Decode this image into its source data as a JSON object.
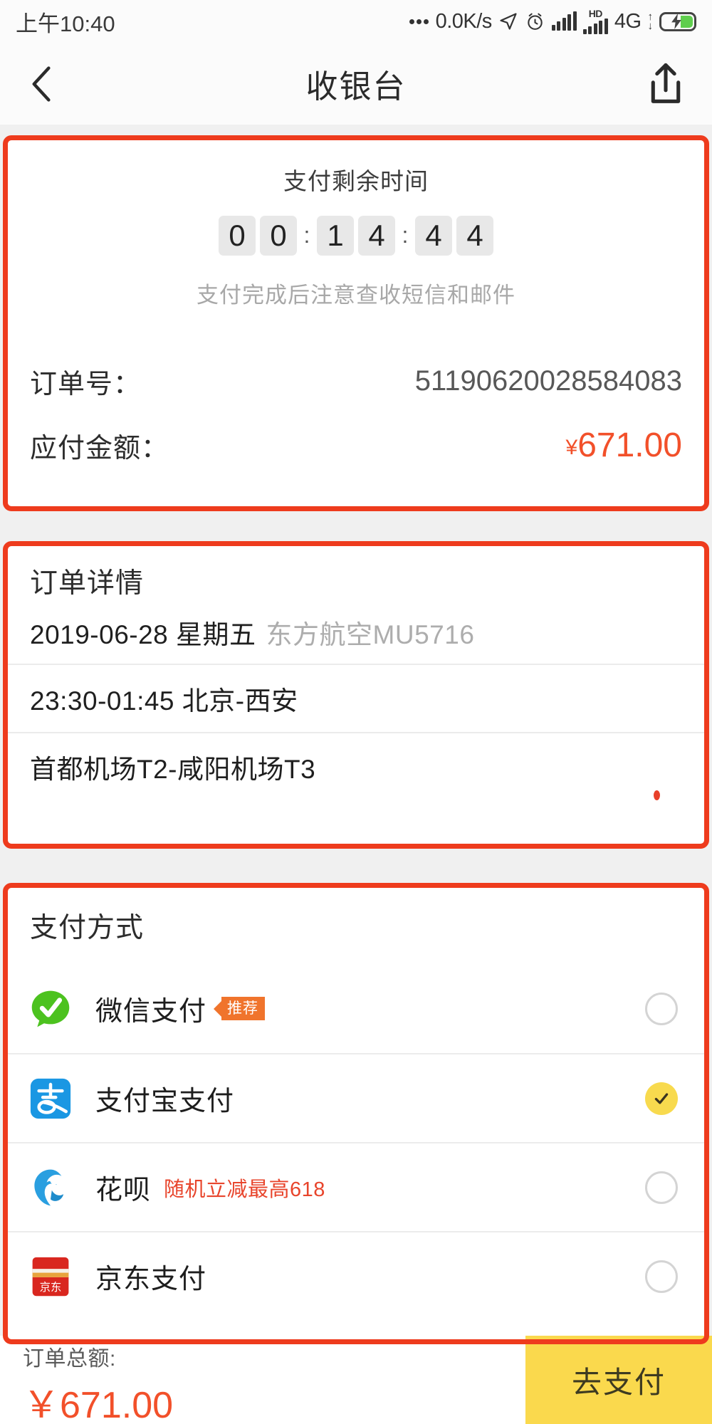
{
  "status_bar": {
    "time": "上午10:40",
    "net_speed": "0.0K/s",
    "hd_label": "HD",
    "network": "4G",
    "icons": [
      "more-dots-icon",
      "location-arrow-icon",
      "alarm-clock-icon",
      "signal-bars-icon",
      "hd-signal-icon",
      "data-transfer-icon",
      "battery-charging-icon"
    ]
  },
  "title_bar": {
    "back": "back-chevron-icon",
    "title": "收银台",
    "share": "share-icon"
  },
  "countdown_card": {
    "label": "支付剩余时间",
    "digits": [
      "0",
      "0",
      "1",
      "4",
      "4",
      "4"
    ],
    "separator": ":",
    "note": "支付完成后注意查收短信和邮件",
    "order_no_label": "订单号：",
    "order_no_value": "51190620028584083",
    "amount_label": "应付金额：",
    "amount_currency": "¥",
    "amount_value": "671.00"
  },
  "order_detail_card": {
    "title": "订单详情",
    "rows": [
      {
        "main": "2019-06-28 星期五",
        "sub": "东方航空MU5716"
      },
      {
        "main": "23:30-01:45 北京-西安",
        "sub": ""
      },
      {
        "main": "首都机场T2-咸阳机场T3",
        "sub": ""
      }
    ]
  },
  "payment_card": {
    "title": "支付方式",
    "methods": [
      {
        "name": "微信支付",
        "icon": "wechat-pay-icon",
        "badge": "推荐",
        "promo": "",
        "selected": false
      },
      {
        "name": "支付宝支付",
        "icon": "alipay-icon",
        "badge": "",
        "promo": "",
        "selected": true
      },
      {
        "name": "花呗",
        "icon": "huabei-icon",
        "badge": "",
        "promo": "随机立减最高618",
        "selected": false
      },
      {
        "name": "京东支付",
        "icon": "jd-pay-icon",
        "badge": "",
        "promo": "",
        "selected": false
      }
    ]
  },
  "bottom_bar": {
    "total_label": "订单总额:",
    "total_amount": "￥671.00",
    "pay_button": "去支付"
  },
  "colors": {
    "accent_red": "#f2502a",
    "annotation_red": "#ee3b1d",
    "pay_button_yellow": "#fad94d",
    "wechat_green": "#4cc21f",
    "alipay_blue": "#1a97e3",
    "badge_orange": "#f0742c"
  }
}
